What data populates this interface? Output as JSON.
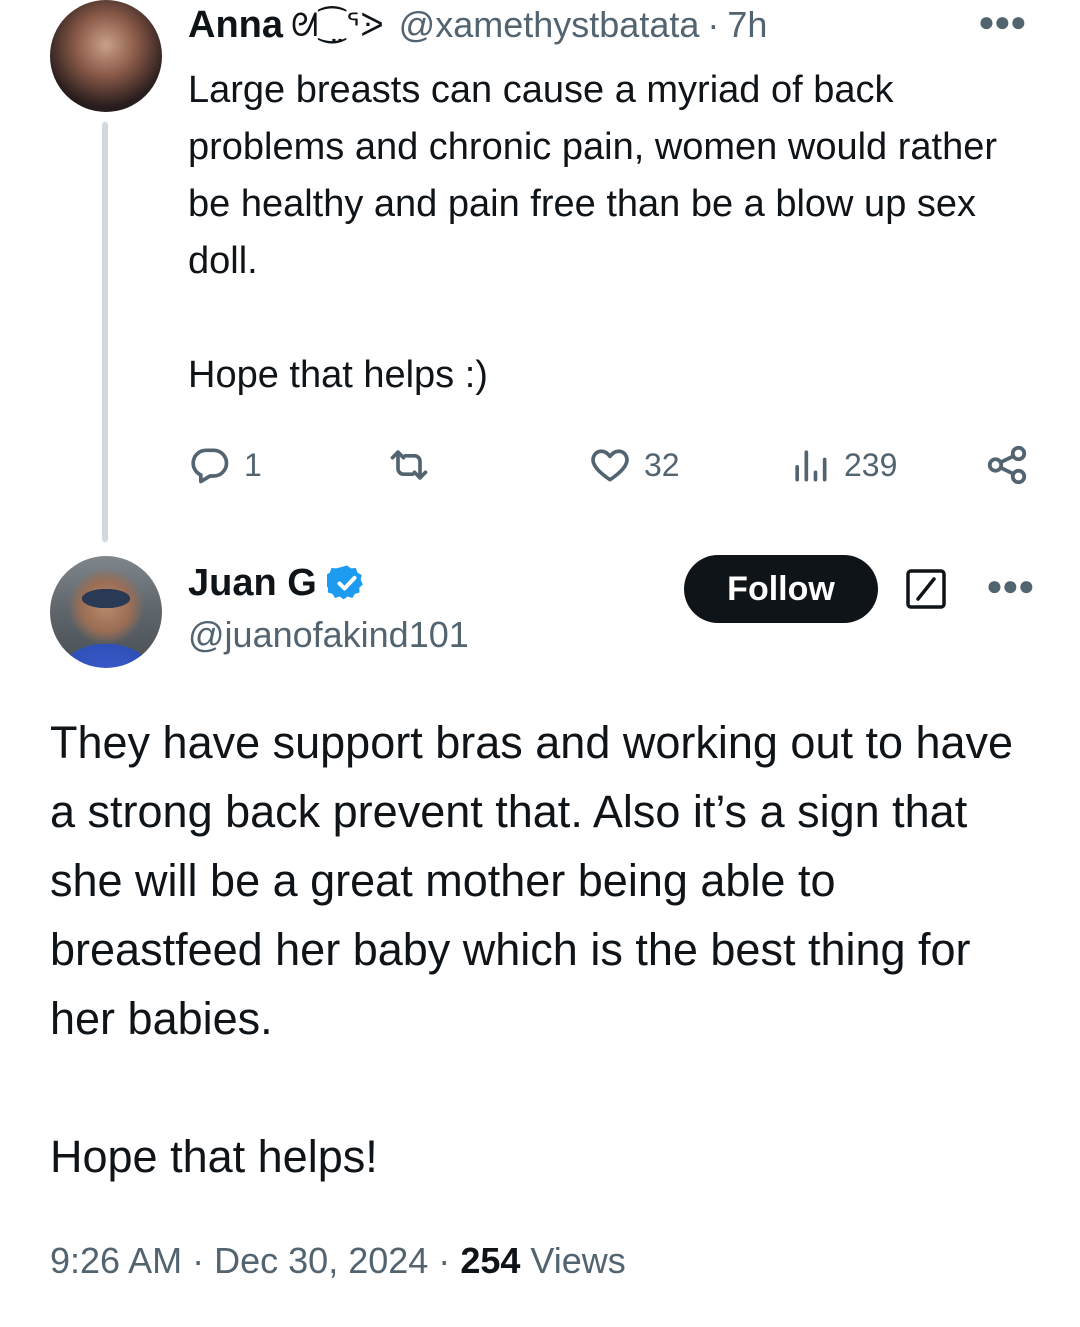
{
  "parent_tweet": {
    "author": {
      "display_name": "Anna",
      "name_decoration": "ᘛ⁐̤ᕐᐷ",
      "handle": "@xamethystbatata"
    },
    "time": "7h",
    "separator": "·",
    "text": "Large breasts can cause a myriad of back problems and chronic pain, women would rather be healthy and pain free than be a blow up sex doll.\n\nHope that helps :)",
    "actions": {
      "replies": "1",
      "retweets": "",
      "likes": "32",
      "views": "239"
    }
  },
  "main_tweet": {
    "author": {
      "display_name": "Juan G",
      "handle": "@juanofakind101",
      "verified": true
    },
    "follow_label": "Follow",
    "text": "They have support bras and working out to have a strong back prevent that. Also it’s a sign that she will be a great mother being able to breastfeed her baby which is the best thing for her babies.\n\nHope that helps!",
    "meta": {
      "time": "9:26 AM",
      "separator": "·",
      "date": "Dec 30, 2024",
      "views_count": "254",
      "views_label": "Views"
    }
  },
  "colors": {
    "text_primary": "#0f1419",
    "text_secondary": "#536471",
    "verified_blue": "#1d9bf0",
    "thread_line": "#cfd9de",
    "follow_button_bg": "#0f1419"
  },
  "icons": {
    "reply": "reply-bubble-icon",
    "retweet": "retweet-arrows-icon",
    "like": "heart-icon",
    "views": "bar-chart-icon",
    "share": "share-nodes-icon",
    "more": "more-dots-icon",
    "verified": "verified-badge-icon",
    "grok": "grok-slash-icon"
  }
}
